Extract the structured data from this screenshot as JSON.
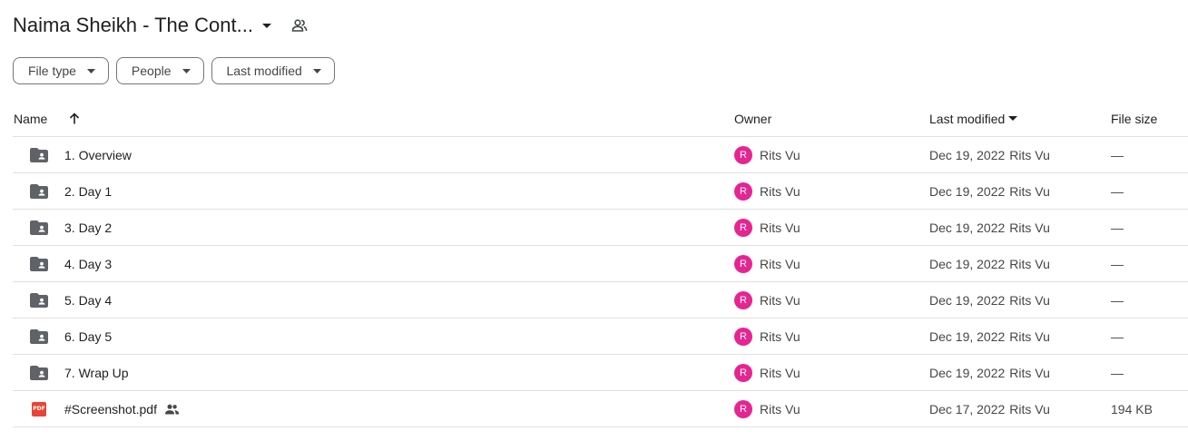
{
  "header": {
    "title": "Naima Sheikh - The Cont...",
    "caret_icon": "arrow-drop-down-icon",
    "shared_icon": "people-icon"
  },
  "filters": [
    {
      "label": "File type"
    },
    {
      "label": "People"
    },
    {
      "label": "Last modified"
    }
  ],
  "columns": {
    "name": "Name",
    "owner": "Owner",
    "last_modified": "Last modified",
    "file_size": "File size"
  },
  "rows": [
    {
      "type": "shared-folder",
      "name": "1. Overview",
      "owner": "Rits Vu",
      "owner_initial": "R",
      "modified_date": "Dec 19, 2022",
      "modified_by": "Rits Vu",
      "size": "—",
      "shared": false
    },
    {
      "type": "shared-folder",
      "name": "2. Day 1",
      "owner": "Rits Vu",
      "owner_initial": "R",
      "modified_date": "Dec 19, 2022",
      "modified_by": "Rits Vu",
      "size": "—",
      "shared": false
    },
    {
      "type": "shared-folder",
      "name": "3. Day 2",
      "owner": "Rits Vu",
      "owner_initial": "R",
      "modified_date": "Dec 19, 2022",
      "modified_by": "Rits Vu",
      "size": "—",
      "shared": false
    },
    {
      "type": "shared-folder",
      "name": "4. Day 3",
      "owner": "Rits Vu",
      "owner_initial": "R",
      "modified_date": "Dec 19, 2022",
      "modified_by": "Rits Vu",
      "size": "—",
      "shared": false
    },
    {
      "type": "shared-folder",
      "name": "5. Day 4",
      "owner": "Rits Vu",
      "owner_initial": "R",
      "modified_date": "Dec 19, 2022",
      "modified_by": "Rits Vu",
      "size": "—",
      "shared": false
    },
    {
      "type": "shared-folder",
      "name": "6. Day 5",
      "owner": "Rits Vu",
      "owner_initial": "R",
      "modified_date": "Dec 19, 2022",
      "modified_by": "Rits Vu",
      "size": "—",
      "shared": false
    },
    {
      "type": "shared-folder",
      "name": "7. Wrap Up",
      "owner": "Rits Vu",
      "owner_initial": "R",
      "modified_date": "Dec 19, 2022",
      "modified_by": "Rits Vu",
      "size": "—",
      "shared": false
    },
    {
      "type": "pdf",
      "name": "#Screenshot.pdf",
      "owner": "Rits Vu",
      "owner_initial": "R",
      "modified_date": "Dec 17, 2022",
      "modified_by": "Rits Vu",
      "size": "194 KB",
      "shared": true
    }
  ],
  "icons": {
    "pdf_badge_text": "PDF"
  },
  "colors": {
    "avatar": "#e52592",
    "pdf": "#ea4335",
    "folder": "#5f6368"
  }
}
